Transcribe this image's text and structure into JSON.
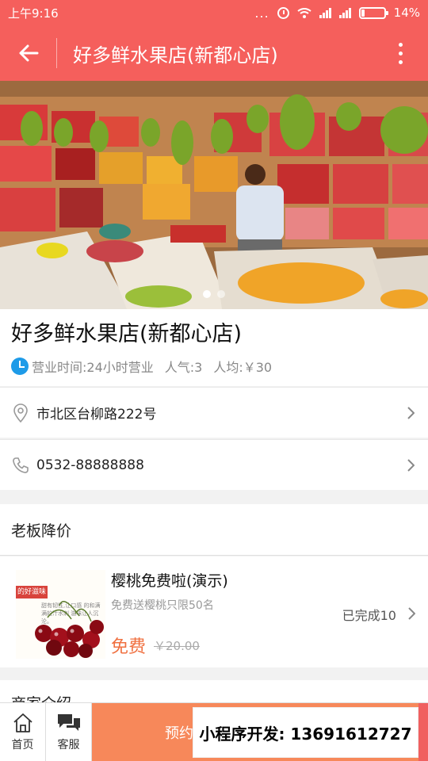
{
  "status_bar": {
    "time": "上午9:16",
    "dots": "...",
    "battery": "14%"
  },
  "nav": {
    "title": "好多鲜水果店(新都心店)"
  },
  "store": {
    "name": "好多鲜水果店(新都心店)",
    "hours": "营业时间:24小时营业",
    "popularity": "人气:3",
    "avg_price": "人均:￥30",
    "address": "市北区台柳路222号",
    "phone": "0532-88888888"
  },
  "promo_section": {
    "title": "老板降价",
    "item": {
      "title": "樱桃免费啦(演示)",
      "desc": "免费送樱桃只限50名",
      "price": "免费",
      "orig_price": "￥20.00",
      "done": "已完成10",
      "thumb_tag": "的好滋味",
      "thumb_text": "甜有韧性,让口感 的和满满的汁水刺 滋味让人沉沦。"
    }
  },
  "next_section": {
    "title": "商家介绍"
  },
  "bottom_bar": {
    "home_label": "首页",
    "service_label": "客服",
    "book_label": "预约",
    "watermark": "小程序开发: 13691612727"
  },
  "colors": {
    "primary": "#f55f5c",
    "accent": "#f7885a",
    "hours_icon": "#1e9be8"
  },
  "banner": {
    "slide_count": 2,
    "active_slide": 1
  }
}
